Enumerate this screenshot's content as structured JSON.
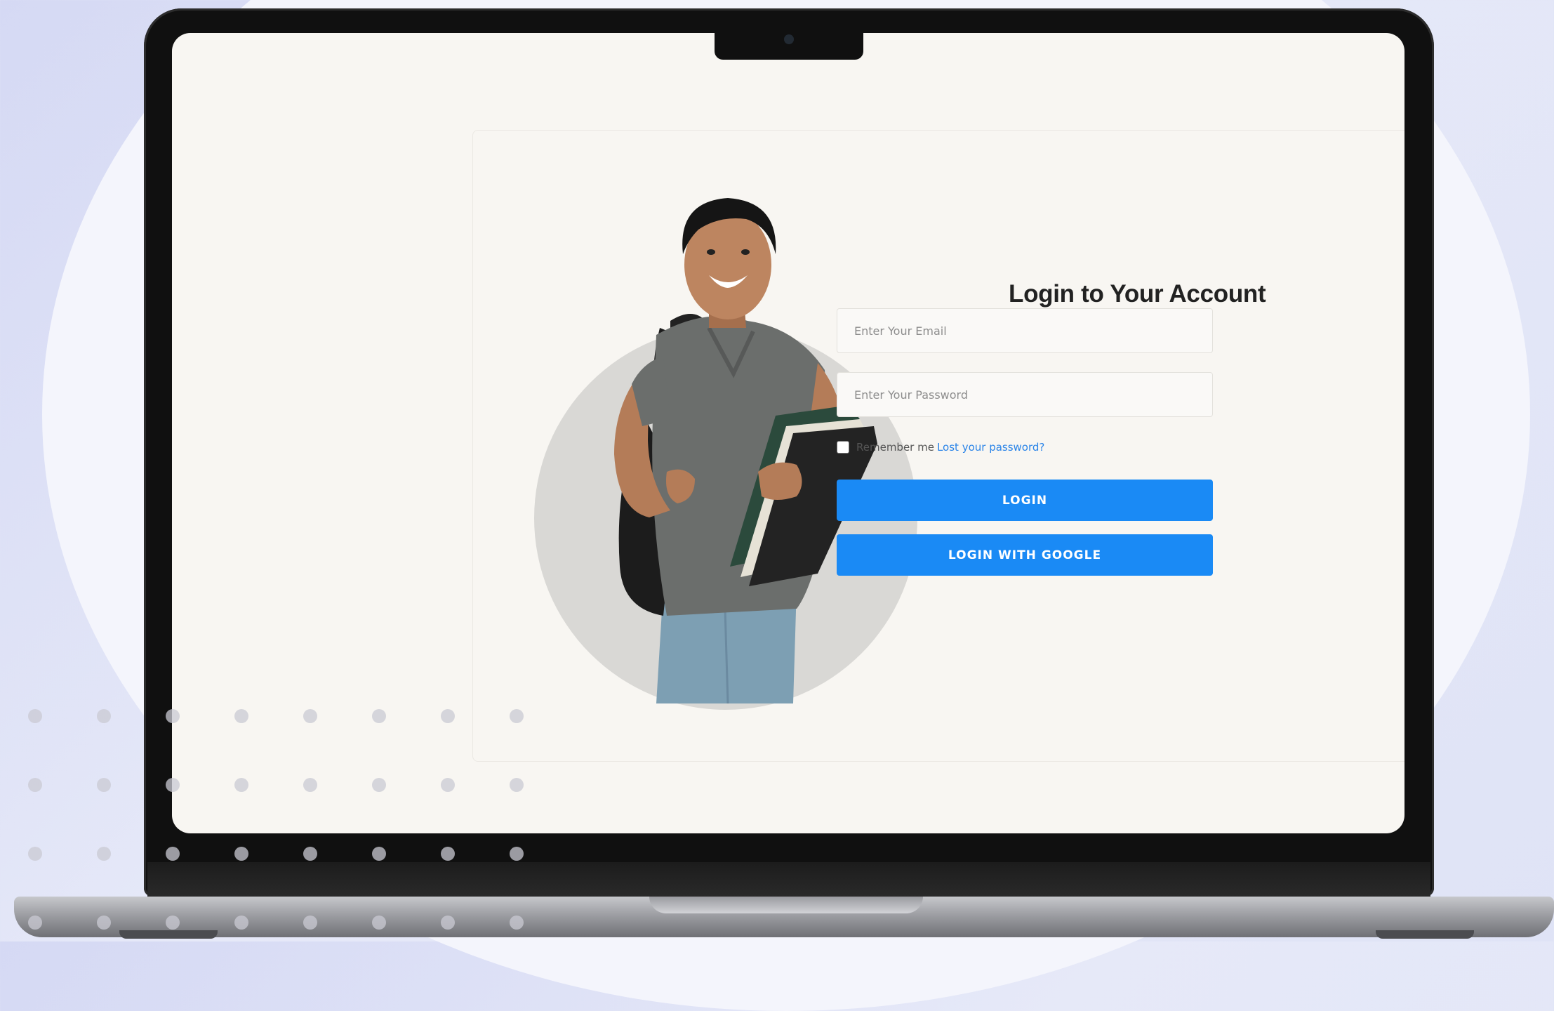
{
  "login": {
    "title": "Login to Your Account",
    "email_placeholder": "Enter Your Email",
    "password_placeholder": "Enter Your Password",
    "remember_label": "Remember me",
    "lost_password_link": "Lost your password?",
    "login_button": "LOGIN",
    "google_button": "LOGIN WITH GOOGLE"
  },
  "colors": {
    "primary_button": "#1a8af5",
    "link": "#2a84e8",
    "screen_bg": "#f8f6f2",
    "page_bg": "#e6e9f8"
  },
  "illustration": {
    "subject": "student-with-backpack-and-books"
  }
}
